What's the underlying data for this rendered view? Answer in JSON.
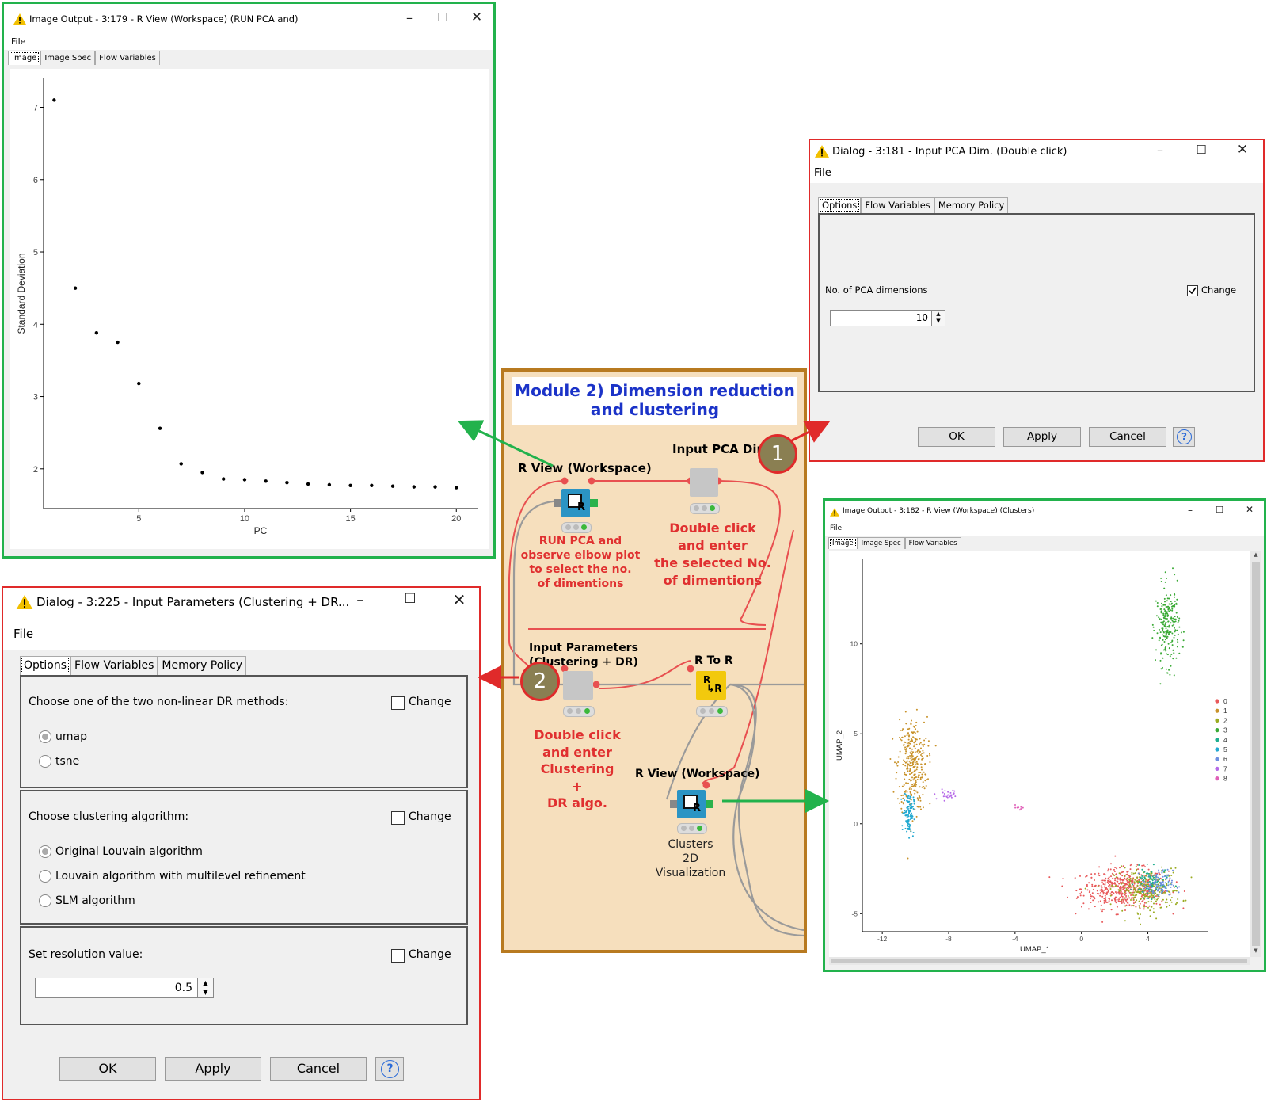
{
  "elbow_window": {
    "title": "Image Output - 3:179 - R View (Workspace) (RUN PCA and)",
    "menu_file": "File",
    "tabs": [
      "Image",
      "Image Spec",
      "Flow Variables"
    ],
    "chart_data": {
      "type": "scatter",
      "xlabel": "PC",
      "ylabel": "Standard Deviation",
      "x_ticks": [
        "5",
        "10",
        "15",
        "20"
      ],
      "y_ticks": [
        "2",
        "3",
        "4",
        "5",
        "6",
        "7"
      ],
      "xlim": [
        0.5,
        21
      ],
      "ylim": [
        1.45,
        7.4
      ],
      "x": [
        1,
        2,
        3,
        4,
        5,
        6,
        7,
        8,
        9,
        10,
        11,
        12,
        13,
        14,
        15,
        16,
        17,
        18,
        19,
        20
      ],
      "y": [
        7.1,
        4.5,
        3.88,
        3.75,
        3.18,
        2.56,
        2.07,
        1.95,
        1.86,
        1.85,
        1.83,
        1.81,
        1.79,
        1.78,
        1.77,
        1.77,
        1.76,
        1.75,
        1.75,
        1.74
      ]
    }
  },
  "pca_dialog": {
    "title": "Dialog - 3:181 - Input PCA Dim. (Double click)",
    "menu_file": "File",
    "tabs": [
      "Options",
      "Flow Variables",
      "Memory Policy"
    ],
    "field_label": "No. of PCA dimensions",
    "change_label": "Change",
    "change_checked": true,
    "value": "10",
    "buttons": {
      "ok": "OK",
      "apply": "Apply",
      "cancel": "Cancel",
      "help": "?"
    }
  },
  "params_dialog": {
    "title": "Dialog - 3:225 - Input Parameters (Clustering + DR...",
    "menu_file": "File",
    "tabs": [
      "Options",
      "Flow Variables",
      "Memory Policy"
    ],
    "change_label": "Change",
    "dr_section": {
      "label": "Choose one of the two non-linear DR methods:",
      "options": [
        "umap",
        "tsne"
      ],
      "selected": "umap"
    },
    "cluster_section": {
      "label": "Choose clustering algorithm:",
      "options": [
        "Original Louvain algorithm",
        "Louvain algorithm with multilevel refinement",
        "SLM algorithm"
      ],
      "selected": "Original Louvain algorithm"
    },
    "resolution_section": {
      "label": "Set resolution value:",
      "value": "0.5"
    },
    "buttons": {
      "ok": "OK",
      "apply": "Apply",
      "cancel": "Cancel",
      "help": "?"
    }
  },
  "workflow": {
    "title_line1": "Module 2) Dimension reduction",
    "title_line2": "and  clustering",
    "nodes": {
      "rview1": "R View (Workspace)",
      "input_pca": "Input PCA Dim.",
      "input_params_l1": "Input Parameters",
      "input_params_l2": "(Clustering + DR)",
      "r_to_r": "R To R",
      "rview2": "R View (Workspace)",
      "clusters_l1": "Clusters",
      "clusters_l2": "2D",
      "clusters_l3": "Visualization"
    },
    "notes": {
      "run_pca": [
        "RUN PCA and",
        "observe elbow plot",
        "to select the no.",
        "of dimentions"
      ],
      "double_click_pca": [
        "Double click",
        "and enter",
        "the selected No.",
        "of dimentions"
      ],
      "double_click_params": [
        "Double click",
        "and enter",
        "Clustering",
        "+",
        "DR algo."
      ]
    },
    "badges": [
      "1",
      "2"
    ]
  },
  "umap_window": {
    "title": "Image Output - 3:182 - R View (Workspace) (Clusters)",
    "menu_file": "File",
    "tabs": [
      "Image",
      "Image Spec",
      "Flow Variables"
    ],
    "chart_data": {
      "type": "scatter",
      "xlabel": "UMAP_1",
      "ylabel": "UMAP_2",
      "x_ticks": [
        "-12",
        "-8",
        "-4",
        "0",
        "4"
      ],
      "y_ticks": [
        "-5",
        "0",
        "5",
        "10"
      ],
      "xlim": [
        -13.2,
        7.6
      ],
      "ylim": [
        -6.0,
        14.7
      ],
      "legend": [
        "0",
        "1",
        "2",
        "3",
        "4",
        "5",
        "6",
        "7",
        "8"
      ],
      "colors": [
        "#e8585a",
        "#c8922a",
        "#9aab20",
        "#3aaa35",
        "#1fae8f",
        "#21a8d0",
        "#6e8fe0",
        "#b66ae8",
        "#e060b8"
      ],
      "clusters": [
        {
          "name": "0",
          "cx": 2.6,
          "cy": -3.6,
          "sx": 1.3,
          "sy": 0.55,
          "n": 500
        },
        {
          "name": "1",
          "cx": -10.2,
          "cy": 3.3,
          "sx": 0.45,
          "sy": 1.3,
          "n": 320
        },
        {
          "name": "2",
          "cx": 4.0,
          "cy": -3.7,
          "sx": 1.0,
          "sy": 0.6,
          "n": 260
        },
        {
          "name": "3",
          "cx": 5.2,
          "cy": 11.0,
          "sx": 0.35,
          "sy": 1.1,
          "n": 220
        },
        {
          "name": "4",
          "cx": 4.2,
          "cy": -3.3,
          "sx": 0.5,
          "sy": 0.4,
          "n": 90
        },
        {
          "name": "5",
          "cx": -10.4,
          "cy": 0.6,
          "sx": 0.15,
          "sy": 0.6,
          "n": 110
        },
        {
          "name": "6",
          "cx": 4.6,
          "cy": -3.4,
          "sx": 0.45,
          "sy": 0.4,
          "n": 90
        },
        {
          "name": "7",
          "cx": -8.0,
          "cy": 1.6,
          "sx": 0.45,
          "sy": 0.15,
          "n": 25
        },
        {
          "name": "8",
          "cx": -3.7,
          "cy": 0.9,
          "sx": 0.12,
          "sy": 0.08,
          "n": 8
        }
      ]
    }
  }
}
